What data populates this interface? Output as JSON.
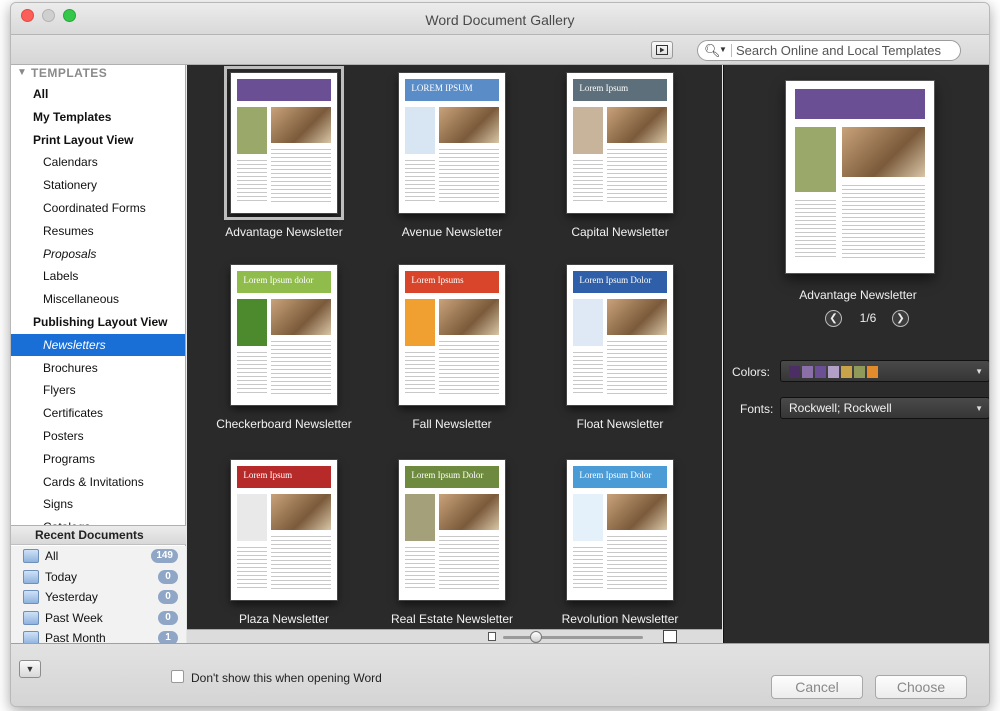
{
  "window": {
    "title": "Word Document Gallery"
  },
  "toolbar": {
    "search_placeholder": "Search Online and Local Templates",
    "search_icon": "magnifier-icon",
    "slideshow_icon": "play-icon"
  },
  "sidebar": {
    "section_title": "TEMPLATES",
    "items": [
      {
        "label": "All",
        "bold": true,
        "indent": 1
      },
      {
        "label": "My Templates",
        "bold": true,
        "indent": 1
      },
      {
        "label": "Print Layout View",
        "bold": true,
        "indent": 1
      },
      {
        "label": "Calendars",
        "indent": 2
      },
      {
        "label": "Stationery",
        "indent": 2
      },
      {
        "label": "Coordinated Forms",
        "indent": 2
      },
      {
        "label": "Resumes",
        "indent": 2
      },
      {
        "label": "Proposals",
        "indent": 2,
        "italic": true
      },
      {
        "label": "Labels",
        "indent": 2
      },
      {
        "label": "Miscellaneous",
        "indent": 2
      },
      {
        "label": "Publishing Layout View",
        "bold": true,
        "indent": 1
      },
      {
        "label": "Newsletters",
        "indent": 2,
        "selected": true
      },
      {
        "label": "Brochures",
        "indent": 2
      },
      {
        "label": "Flyers",
        "indent": 2
      },
      {
        "label": "Certificates",
        "indent": 2
      },
      {
        "label": "Posters",
        "indent": 2
      },
      {
        "label": "Programs",
        "indent": 2
      },
      {
        "label": "Cards & Invitations",
        "indent": 2
      },
      {
        "label": "Signs",
        "indent": 2
      },
      {
        "label": "Catalogs",
        "indent": 2
      }
    ],
    "recent_title": "Recent Documents",
    "recent": [
      {
        "label": "All",
        "count": "149"
      },
      {
        "label": "Today",
        "count": "0"
      },
      {
        "label": "Yesterday",
        "count": "0"
      },
      {
        "label": "Past Week",
        "count": "0"
      },
      {
        "label": "Past Month",
        "count": "1"
      }
    ]
  },
  "gallery": {
    "templates": [
      {
        "name": "Advantage Newsletter",
        "selected": true,
        "heading": "",
        "accent": "#6b4f94",
        "accent2": "#9aa86a"
      },
      {
        "name": "Avenue Newsletter",
        "heading": "LOREM IPSUM",
        "accent": "#5a8cc8",
        "accent2": "#d8e6f4"
      },
      {
        "name": "Capital Newsletter",
        "heading": "Lorem Ipsum",
        "accent": "#5d6f7a",
        "accent2": "#c8b49a"
      },
      {
        "name": "Checkerboard Newsletter",
        "heading": "Lorem Ipsum dolor",
        "accent": "#8fbc4a",
        "accent2": "#4d8a2e"
      },
      {
        "name": "Fall Newsletter",
        "heading": "Lorem Ipsums",
        "accent": "#d8452a",
        "accent2": "#f0a030"
      },
      {
        "name": "Float Newsletter",
        "heading": "Lorem Ipsum Dolor",
        "accent": "#2f5fa8",
        "accent2": "#dfe9f6"
      },
      {
        "name": "Plaza Newsletter",
        "heading": "Lorem Ipsum",
        "accent": "#b62a2a",
        "accent2": "#e9e9e9"
      },
      {
        "name": "Real Estate Newsletter",
        "heading": "Lorem Ipsum Dolor",
        "accent": "#6d8a3e",
        "accent2": "#a3a07a"
      },
      {
        "name": "Revolution Newsletter",
        "heading": "Lorem Ipsum Dolor",
        "accent": "#4a9bd6",
        "accent2": "#e4f1fa"
      }
    ]
  },
  "preview": {
    "name": "Advantage Newsletter",
    "page": "1/6",
    "colors_label": "Colors:",
    "fonts_label": "Fonts:",
    "fonts_value": "Rockwell; Rockwell",
    "swatches": [
      "#4b2e63",
      "#8a6fa8",
      "#6b4f94",
      "#b2a0c8",
      "#c9a34a",
      "#8f9a5a",
      "#e18b2c"
    ]
  },
  "footer": {
    "dont_show_label": "Don't show this when opening Word",
    "cancel_label": "Cancel",
    "choose_label": "Choose"
  }
}
